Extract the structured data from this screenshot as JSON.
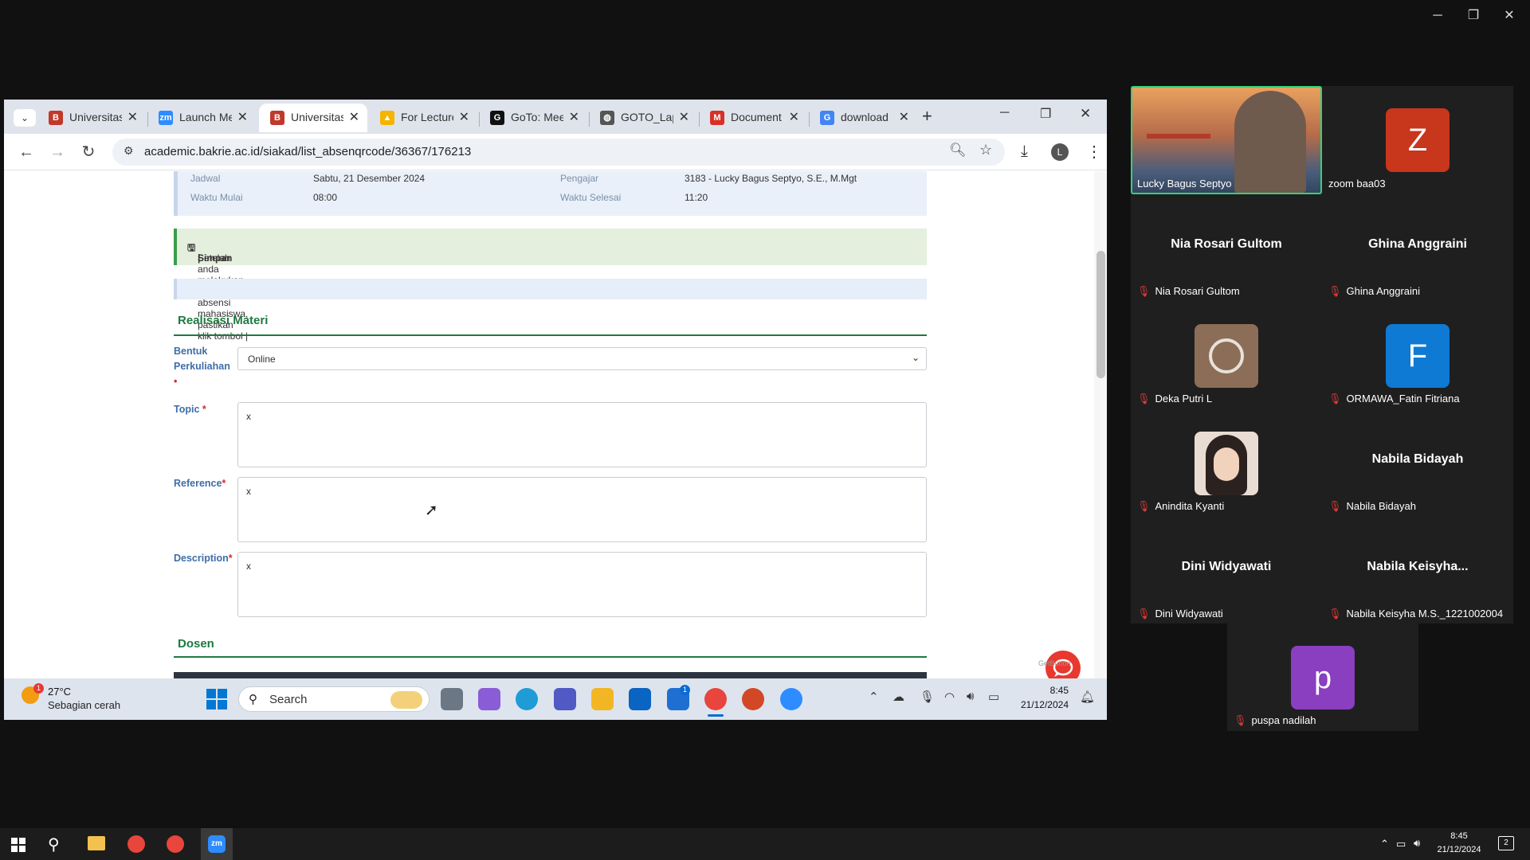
{
  "chrome": {
    "tabs": [
      {
        "label": "Universitas",
        "icon": "bakrie-shield-icon",
        "color": "#c0392b"
      },
      {
        "label": "Launch Meeting",
        "icon": "zoom-icon",
        "color": "#2d8cff"
      },
      {
        "label": "Universitas",
        "icon": "bakrie-shield-icon",
        "color": "#c0392b",
        "active": true
      },
      {
        "label": "For Lecturer",
        "icon": "google-drive-icon",
        "color": "#f4b400"
      },
      {
        "label": "GoTo: Meeting",
        "icon": "goto-icon",
        "color": "#111111"
      },
      {
        "label": "GOTO_Lap",
        "icon": "globe-icon",
        "color": "#555555"
      },
      {
        "label": "Document",
        "icon": "gmail-icon",
        "color": "#d93025"
      },
      {
        "label": "download",
        "icon": "google-icon",
        "color": "#4285f4"
      }
    ],
    "url": "academic.bakrie.ac.id/siakad/list_absenqrcode/36367/176213",
    "profile_initial": "L"
  },
  "page": {
    "info": {
      "jadwal_label": "Jadwal",
      "jadwal_value": "Sabtu, 21 Desember 2024",
      "waktu_mulai_label": "Waktu Mulai",
      "waktu_mulai_value": "08:00",
      "pengajar_label": "Pengajar",
      "pengajar_value": "3183 - Lucky Bagus Septyo, S.E., M.Mgt",
      "waktu_selesai_label": "Waktu Selesai",
      "waktu_selesai_value": "11:20"
    },
    "alert_text": "Setelah anda melakukan perubahan absensi mahasiswa, pastikan klik tombol |",
    "alert_button": "Simpan",
    "alert_tail": "|",
    "section_realisasi": "Realisasi Materi",
    "bentuk_label_1": "Bentuk",
    "bentuk_label_2": "Perkuliahan",
    "bentuk_value": "Online",
    "topic_label": "Topic",
    "topic_value": "x",
    "reference_label": "Reference",
    "reference_value": "x",
    "description_label": "Description",
    "description_value": "x",
    "section_dosen": "Dosen",
    "getbutton": "GetButton"
  },
  "inner_taskbar": {
    "weather_temp": "27°C",
    "weather_desc": "Sebagian cerah",
    "weather_badge": "1",
    "search_placeholder": "Search",
    "mail_badge": "1",
    "time": "8:45",
    "date": "21/12/2024"
  },
  "zoom": {
    "participants": [
      {
        "name": "Lucky Bagus Septyo",
        "video": true
      },
      {
        "name": "zoom baa03",
        "avatar": "Z",
        "color": "#c8361c"
      },
      {
        "name": "Nia Rosari Gultom",
        "big": "Nia Rosari Gultom"
      },
      {
        "name": "Ghina Anggraini",
        "big": "Ghina Anggraini"
      },
      {
        "name": "Deka Putri L",
        "photo": true
      },
      {
        "name": "ORMAWA_Fatin Fitriana",
        "avatar": "F",
        "color": "#0e7ad4"
      },
      {
        "name": "Anindita Kyanti",
        "photo": true
      },
      {
        "name": "Nabila Bidayah",
        "big": "Nabila Bidayah"
      },
      {
        "name": "Dini Widyawati",
        "big": "Dini Widyawati"
      },
      {
        "name": "Nabila Keisyha M.S._1221002004",
        "big": "Nabila  Keisyha..."
      },
      {
        "name": "puspa nadilah",
        "avatar": "p",
        "color": "#8a3ec0"
      }
    ]
  },
  "outer_taskbar": {
    "time": "8:45",
    "date": "21/12/2024",
    "notif_count": "2"
  }
}
